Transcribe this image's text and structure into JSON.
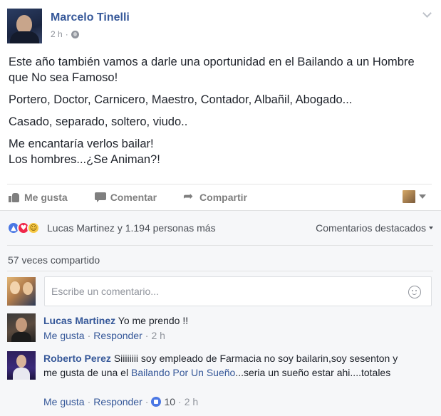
{
  "post": {
    "author": "Marcelo Tinelli",
    "time": "2 h",
    "separator": "·",
    "paragraphs": [
      "Este año también vamos a darle una oportunidad en el Bailando a un Hombre que No sea Famoso!",
      "Portero, Doctor, Carnicero, Maestro, Contador, Albañil, Abogado...",
      "Casado, separado, soltero, viudo..",
      "Me encantaría verlos bailar!",
      "Los hombres...¿Se Animan?!"
    ]
  },
  "actions": {
    "like": "Me gusta",
    "comment": "Comentar",
    "share": "Compartir"
  },
  "reactions": {
    "summary": "Lucas Martinez y 1.194 personas más",
    "sort_label": "Comentarios destacados",
    "icons": [
      "like-icon",
      "love-icon",
      "haha-icon"
    ]
  },
  "shares": "57 veces compartido",
  "composer": {
    "placeholder": "Escribe un comentario..."
  },
  "comments": [
    {
      "author": "Lucas Martinez",
      "text": "Yo me prendo !!",
      "like_label": "Me gusta",
      "reply_label": "Responder",
      "time": "2 h"
    },
    {
      "author": "Roberto Perez",
      "text_before": "Siiiiiiii soy empleado de Farmacia no soy bailarin,soy sesenton y me gusta de una el ",
      "link_text": "Bailando Por Un Sueño",
      "text_after": "...seria un sueño estar ahi....totales",
      "like_label": "Me gusta",
      "reply_label": "Responder",
      "likes": "10",
      "time": "2 h"
    }
  ],
  "colors": {
    "link_blue": "#365899",
    "meta_gray": "#90949c",
    "comments_bg": "#f6f7f9",
    "like_blue": "#4a77e4",
    "love_red": "#f0284a",
    "haha_yellow": "#f7c843"
  }
}
